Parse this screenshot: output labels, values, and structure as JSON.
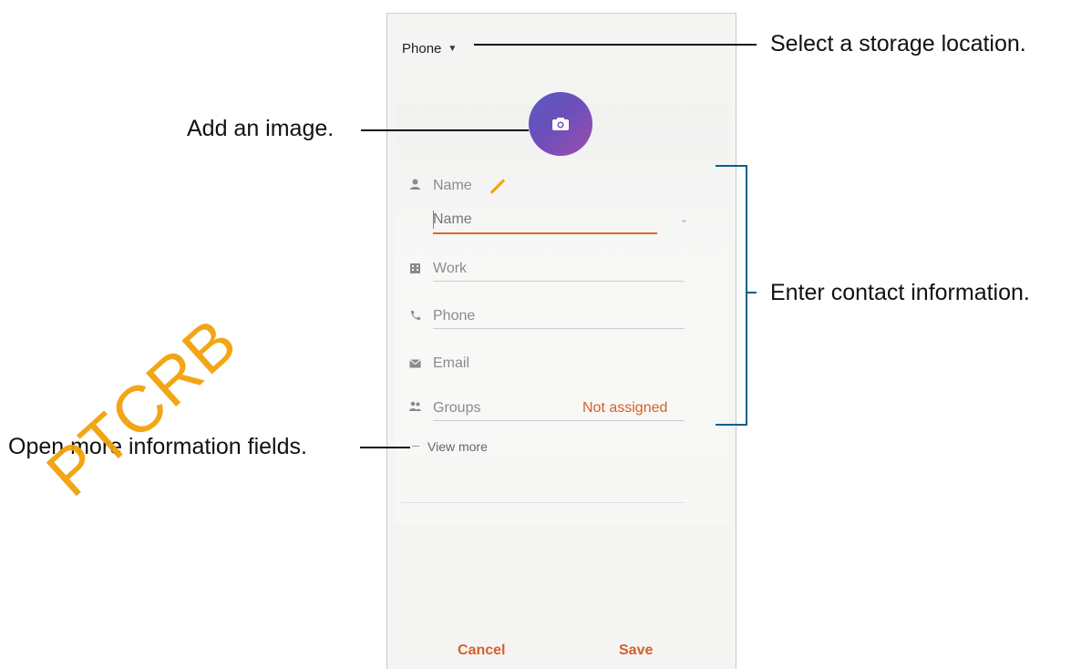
{
  "phone_screen": {
    "storage": {
      "label": "Phone",
      "dropdown_icon": "caret-down-icon"
    },
    "avatar": {
      "icon": "camera-icon",
      "colors": [
        "#5a5ac2",
        "#9a4fb0"
      ]
    },
    "fields": {
      "name": {
        "label": "Name",
        "placeholder": "Name",
        "icon": "person-icon",
        "expand_icon": "chevron-down-icon"
      },
      "work": {
        "label": "Work",
        "icon": "building-icon"
      },
      "phone": {
        "label": "Phone",
        "icon": "phone-icon"
      },
      "email": {
        "label": "Email",
        "icon": "envelope-icon"
      },
      "groups": {
        "label": "Groups",
        "value": "Not assigned",
        "icon": "group-icon"
      }
    },
    "view_more": "View more",
    "buttons": {
      "cancel": "Cancel",
      "save": "Save"
    },
    "accent_color": "#d4602a"
  },
  "annotations": {
    "storage": "Select a storage location.",
    "image": "Add an image.",
    "contact_info": "Enter contact information.",
    "more_fields": "Open more information fields."
  },
  "watermark": "PTCRB"
}
